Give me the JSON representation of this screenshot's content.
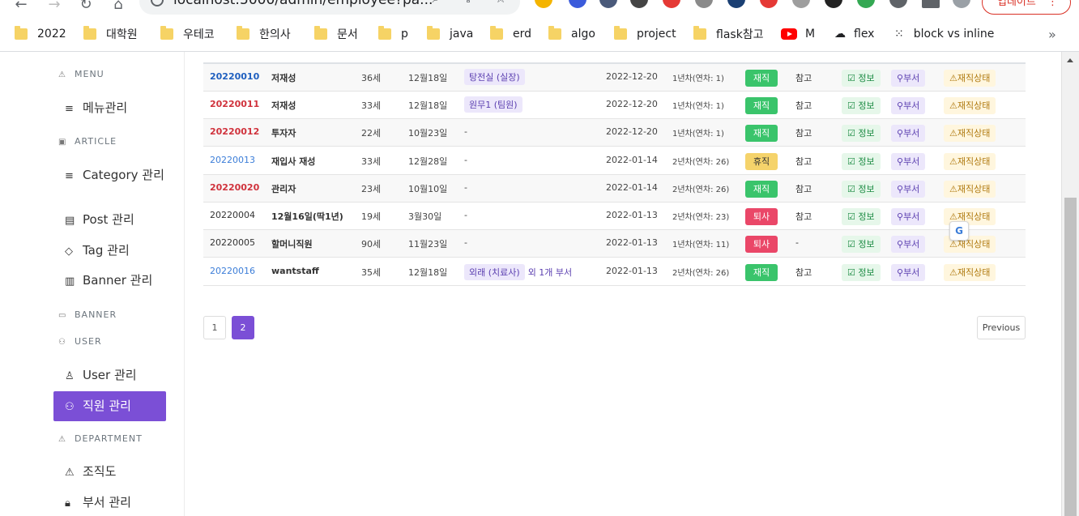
{
  "browser": {
    "url": "localhost:5000/admin/employee?pa...",
    "update_label": "업데이트"
  },
  "bookmarks": [
    {
      "label": "2022",
      "icon": "folder-icon"
    },
    {
      "label": "대학원",
      "icon": "folder-icon"
    },
    {
      "label": "우테코",
      "icon": "folder-icon"
    },
    {
      "label": "한의사",
      "icon": "folder-icon"
    },
    {
      "label": "문서",
      "icon": "folder-icon"
    },
    {
      "label": "p",
      "icon": "folder-icon"
    },
    {
      "label": "java",
      "icon": "folder-icon"
    },
    {
      "label": "erd",
      "icon": "folder-icon"
    },
    {
      "label": "algo",
      "icon": "folder-icon"
    },
    {
      "label": "project",
      "icon": "folder-icon"
    },
    {
      "label": "flask참고",
      "icon": "folder-icon"
    },
    {
      "label": "M",
      "icon": "youtube-icon"
    },
    {
      "label": "flex",
      "icon": "cloud-icon"
    },
    {
      "label": "block vs inline",
      "icon": "dots-icon"
    }
  ],
  "sidebar": {
    "menu_section": "MENU",
    "menu_manage": "메뉴관리",
    "article_section": "ARTICLE",
    "category_manage": "Category 관리",
    "post_manage": "Post 관리",
    "tag_manage": "Tag 관리",
    "banner_manage": "Banner 관리",
    "banner_section": "BANNER",
    "user_section": "USER",
    "user_manage": "User 관리",
    "employee_manage": "직원 관리",
    "department_section": "DEPARTMENT",
    "org_chart": "조직도",
    "dept_manage": "부서 관리"
  },
  "table": {
    "rows": [
      {
        "id": "20220010",
        "id_style": "blue",
        "name": "저재성",
        "age": "36세",
        "birthday": "12월18일",
        "dept": "탕전실 (실장)",
        "dept_more": "",
        "join_date": "2022-12-20",
        "year": "1년차(연차: 1)",
        "status": "재직",
        "status_color": "green",
        "ref": "참고"
      },
      {
        "id": "20220011",
        "id_style": "red",
        "name": "저재성",
        "age": "33세",
        "birthday": "12월18일",
        "dept": "원무1 (팀원)",
        "dept_more": "",
        "join_date": "2022-12-20",
        "year": "1년차(연차: 1)",
        "status": "재직",
        "status_color": "green",
        "ref": "참고"
      },
      {
        "id": "20220012",
        "id_style": "red",
        "name": "투자자",
        "age": "22세",
        "birthday": "10월23일",
        "dept": "-",
        "dept_more": "",
        "join_date": "2022-12-20",
        "year": "1년차(연차: 1)",
        "status": "재직",
        "status_color": "green",
        "ref": "참고"
      },
      {
        "id": "20220013",
        "id_style": "lightblue",
        "name": "재입사 재성",
        "age": "33세",
        "birthday": "12월28일",
        "dept": "-",
        "dept_more": "",
        "join_date": "2022-01-14",
        "year": "2년차(연차: 26)",
        "status": "휴직",
        "status_color": "yellow",
        "ref": "참고"
      },
      {
        "id": "20220020",
        "id_style": "red",
        "name": "관리자",
        "age": "23세",
        "birthday": "10월10일",
        "dept": "-",
        "dept_more": "",
        "join_date": "2022-01-14",
        "year": "2년차(연차: 26)",
        "status": "재직",
        "status_color": "green",
        "ref": "참고"
      },
      {
        "id": "20220004",
        "id_style": "plain",
        "name": "12월16일(딱1년)",
        "age": "19세",
        "birthday": "3월30일",
        "dept": "-",
        "dept_more": "",
        "join_date": "2022-01-13",
        "year": "2년차(연차: 23)",
        "status": "퇴사",
        "status_color": "red",
        "ref": "참고"
      },
      {
        "id": "20220005",
        "id_style": "plain",
        "name": "할머니직원",
        "age": "90세",
        "birthday": "11월23일",
        "dept": "-",
        "dept_more": "",
        "join_date": "2022-01-13",
        "year": "1년차(연차: 11)",
        "status": "퇴사",
        "status_color": "red",
        "ref": "-"
      },
      {
        "id": "20220016",
        "id_style": "lightblue",
        "name": "wantstaff",
        "age": "35세",
        "birthday": "12월18일",
        "dept": "외래 (치료사)",
        "dept_more": "외 1개 부서",
        "join_date": "2022-01-13",
        "year": "2년차(연차: 26)",
        "status": "재직",
        "status_color": "green",
        "ref": "참고"
      }
    ],
    "actions": {
      "info": "정보",
      "dept": "부서",
      "status": "재직상태"
    }
  },
  "pagination": {
    "pages": [
      "1",
      "2"
    ],
    "active": "2",
    "previous": "Previous"
  }
}
